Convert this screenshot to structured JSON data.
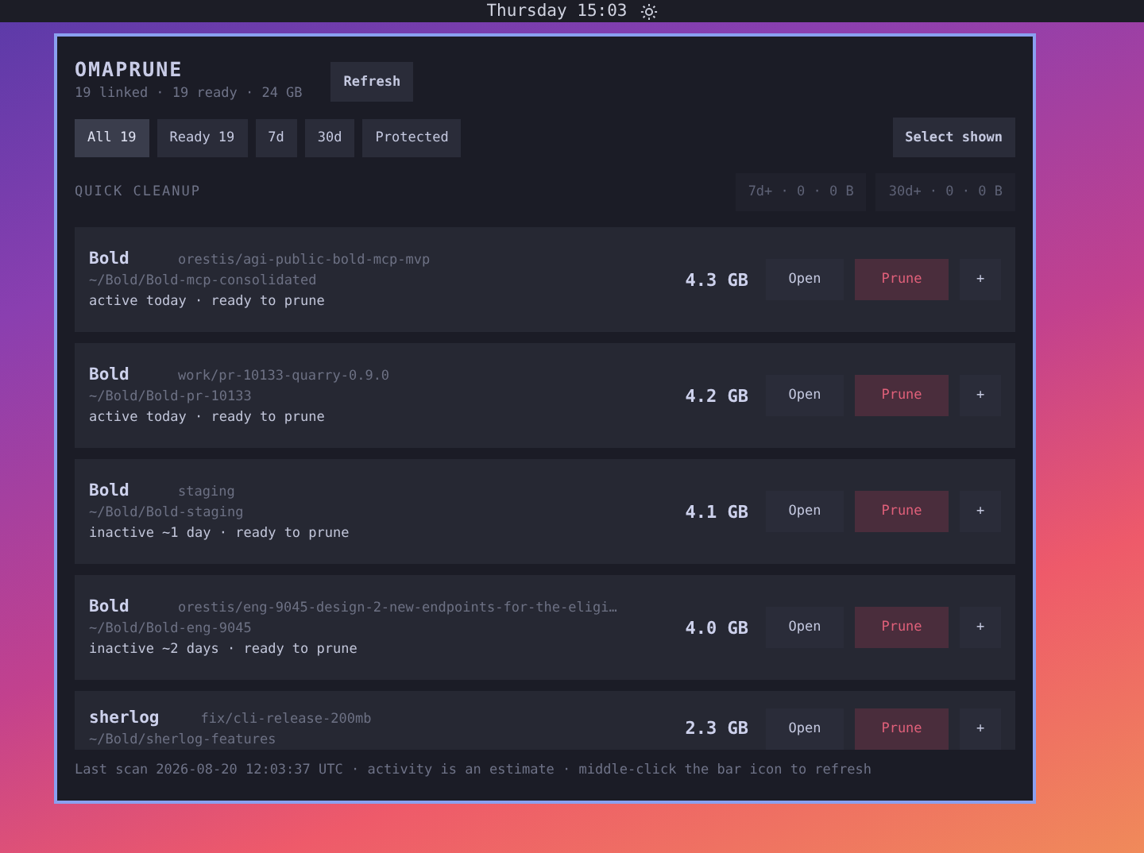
{
  "top_bar": {
    "clock": "Thursday 15:03"
  },
  "app": {
    "title": "OMAPRUNE",
    "summary": "19 linked · 19 ready · 24 GB",
    "refresh": "Refresh"
  },
  "filters": [
    {
      "label": "All 19",
      "selected": true
    },
    {
      "label": "Ready 19",
      "selected": false
    },
    {
      "label": "7d",
      "selected": false
    },
    {
      "label": "30d",
      "selected": false
    },
    {
      "label": "Protected",
      "selected": false
    }
  ],
  "select_shown": "Select shown",
  "quick_cleanup": {
    "heading": "QUICK CLEANUP",
    "buttons": [
      "7d+ · 0 · 0 B",
      "30d+ · 0 · 0 B"
    ]
  },
  "worktrees": [
    {
      "repo": "Bold",
      "branch": "orestis/agi-public-bold-mcp-mvp",
      "path": "~/Bold/Bold-mcp-consolidated",
      "status": "active today · ready to prune",
      "size": "4.3 GB",
      "open": "Open",
      "prune": "Prune",
      "more": "+"
    },
    {
      "repo": "Bold",
      "branch": "work/pr-10133-quarry-0.9.0",
      "path": "~/Bold/Bold-pr-10133",
      "status": "active today · ready to prune",
      "size": "4.2 GB",
      "open": "Open",
      "prune": "Prune",
      "more": "+"
    },
    {
      "repo": "Bold",
      "branch": "staging",
      "path": "~/Bold/Bold-staging",
      "status": "inactive ~1 day · ready to prune",
      "size": "4.1 GB",
      "open": "Open",
      "prune": "Prune",
      "more": "+"
    },
    {
      "repo": "Bold",
      "branch": "orestis/eng-9045-design-2-new-endpoints-for-the-eligi…",
      "path": "~/Bold/Bold-eng-9045",
      "status": "inactive ~2 days · ready to prune",
      "size": "4.0 GB",
      "open": "Open",
      "prune": "Prune",
      "more": "+"
    },
    {
      "repo": "sherlog",
      "branch": "fix/cli-release-200mb",
      "path": "~/Bold/sherlog-features",
      "size": "2.3 GB",
      "open": "Open",
      "prune": "Prune",
      "more": "+"
    }
  ],
  "footer": "Last scan 2026-08-20 12:03:37 UTC · activity is an estimate · middle-click the bar icon to refresh"
}
